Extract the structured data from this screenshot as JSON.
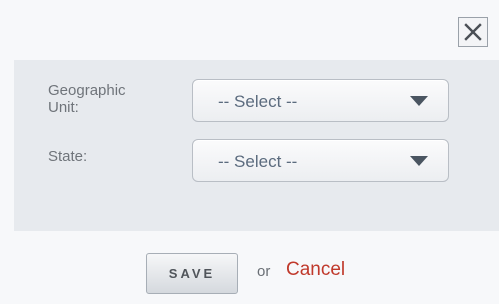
{
  "dialog": {
    "close_icon": "close-x-icon"
  },
  "form": {
    "geographic_unit": {
      "label": "Geographic Unit:",
      "selected": "-- Select --",
      "icon": "dropdown-triangle-icon"
    },
    "state": {
      "label": "State:",
      "selected": "-- Select --",
      "icon": "dropdown-triangle-icon"
    }
  },
  "footer": {
    "save_label": "SAVE",
    "or_text": "or",
    "cancel_label": "Cancel"
  },
  "colors": {
    "cancel": "#c0392b",
    "panel": "#e7eaee",
    "background": "#f7f8fa"
  }
}
